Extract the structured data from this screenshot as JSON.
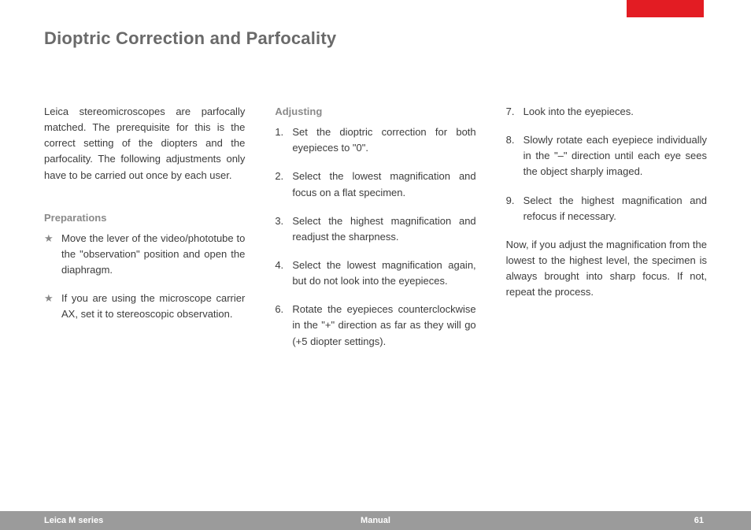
{
  "title": "Dioptric Correction and Parfocality",
  "intro": "Leica stereomicroscopes are parfocally matched. The prerequisite for this is the correct setting of the diopters and the parfocality. The following adjustments only have to be carried out once by each user.",
  "preparations_label": "Preparations",
  "preparations": [
    "Move the lever of the video/phototube to the \"observation\" position and open the diaphragm.",
    "If you are using the microscope carrier AX, set it to stereoscopic observation."
  ],
  "adjusting_label": "Adjusting",
  "adjusting_col2": [
    {
      "n": "1.",
      "text": "Set the dioptric correction for both eyepieces to \"0\"."
    },
    {
      "n": "2.",
      "text": "Select the lowest magnification and focus on a flat specimen."
    },
    {
      "n": "3.",
      "text": "Select the highest magnification and readjust the sharpness."
    },
    {
      "n": "4.",
      "text": "Select the lowest magnification again, but do not look into the eyepieces."
    },
    {
      "n": "6.",
      "text": "Rotate the eyepieces counterclockwise in the \"+\" direction as far as they will go (+5 diopter settings)."
    }
  ],
  "adjusting_col3": [
    {
      "n": "7.",
      "text": "Look into the eyepieces."
    },
    {
      "n": "8.",
      "text": "Slowly rotate each eyepiece individually in the \"–\" direction until each eye sees the object sharply imaged."
    },
    {
      "n": "9.",
      "text": "Select the highest magnification and refocus if necessary."
    }
  ],
  "closing": "Now, if you adjust the magnification from the lowest to the highest level, the specimen is always brought into sharp focus. If not, repeat the process.",
  "footer": {
    "left": "Leica M series",
    "center": "Manual",
    "page": "61"
  }
}
